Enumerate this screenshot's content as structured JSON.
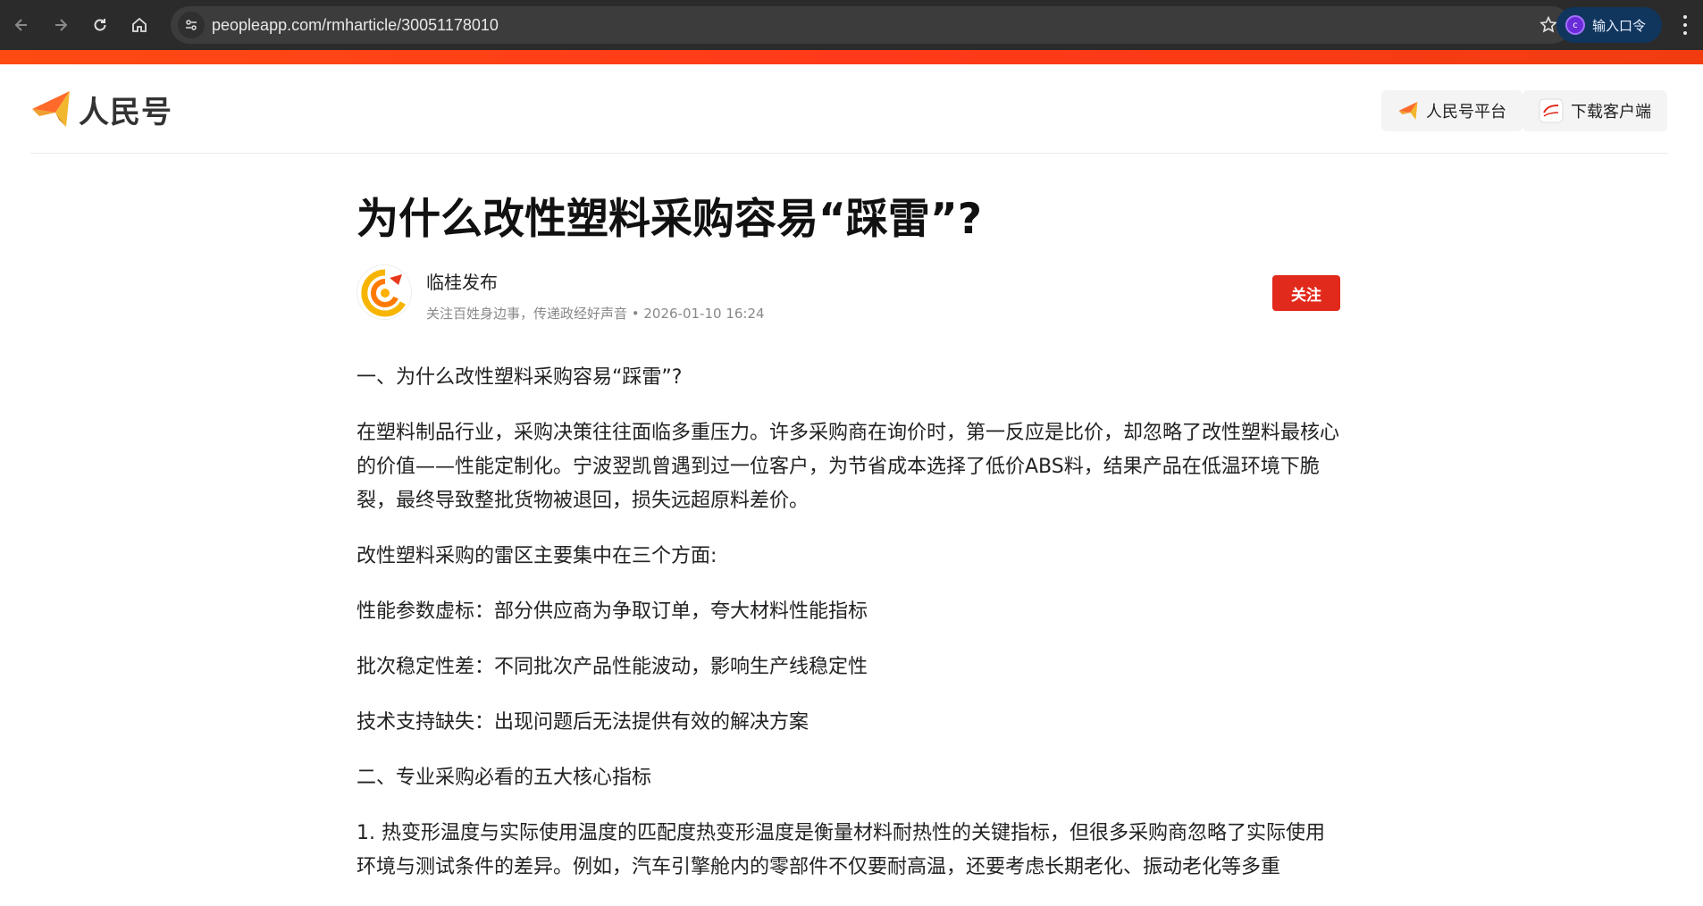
{
  "browser": {
    "url": "peopleapp.com/rmharticle/30051178010",
    "extension_label": "输入口令",
    "extension_icon_letter": "c"
  },
  "header": {
    "logo_text": "人民号",
    "platform_button": "人民号平台",
    "download_button": "下载客户端"
  },
  "article": {
    "title": "为什么改性塑料采购容易“踩雷”?",
    "author_name": "临桂发布",
    "author_meta": "关注百姓身边事，传递政经好声音 • 2026-01-10 16:24",
    "follow_label": "关注",
    "paragraphs": [
      "一、为什么改性塑料采购容易“踩雷”?",
      "在塑料制品行业，采购决策往往面临多重压力。许多采购商在询价时，第一反应是比价，却忽略了改性塑料最核心的价值——性能定制化。宁波翌凯曾遇到过一位客户，为节省成本选择了低价ABS料，结果产品在低温环境下脆裂，最终导致整批货物被退回，损失远超原料差价。",
      "改性塑料采购的雷区主要集中在三个方面:",
      "性能参数虚标：部分供应商为争取订单，夸大材料性能指标",
      "批次稳定性差：不同批次产品性能波动，影响生产线稳定性",
      "技术支持缺失：出现问题后无法提供有效的解决方案",
      "二、专业采购必看的五大核心指标",
      "1. 热变形温度与实际使用温度的匹配度热变形温度是衡量材料耐热性的关键指标，但很多采购商忽略了实际使用环境与测试条件的差异。例如，汽车引擎舱内的零部件不仅要耐高温，还要考虑长期老化、振动老化等多重"
    ]
  },
  "colors": {
    "accent_red": "#e12a1c",
    "top_bar_orange": "#ff4a12",
    "chrome_dark": "#2b2b2b"
  }
}
